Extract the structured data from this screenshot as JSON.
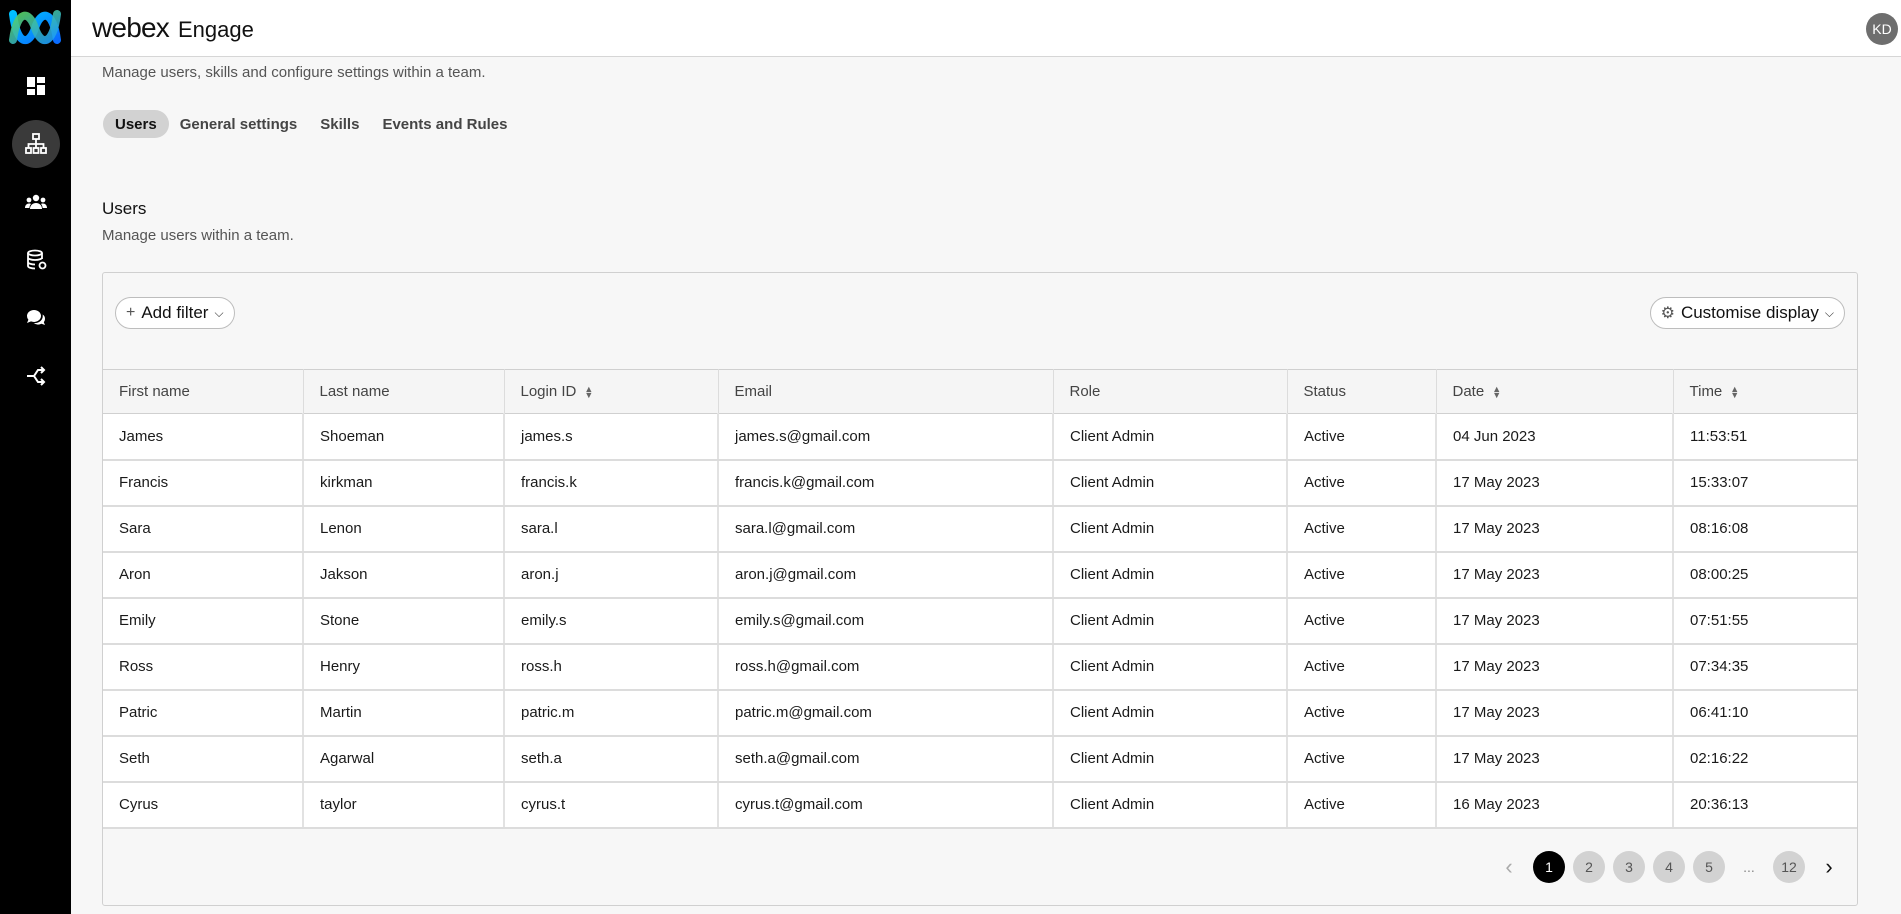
{
  "header": {
    "brand": "webex",
    "product": "Engage",
    "user_initials": "KD"
  },
  "sidebar": {
    "items": [
      {
        "icon": "dashboard-icon"
      },
      {
        "icon": "org-chart-icon",
        "active": true
      },
      {
        "icon": "team-icon"
      },
      {
        "icon": "database-icon"
      },
      {
        "icon": "chat-bubbles-icon"
      },
      {
        "icon": "routing-icon"
      }
    ]
  },
  "page": {
    "subtitle": "Manage users, skills and configure settings within a team.",
    "tabs": [
      "Users",
      "General settings",
      "Skills",
      "Events and Rules"
    ],
    "active_tab": "Users",
    "section_title": "Users",
    "section_desc": "Manage users within a team."
  },
  "toolbar": {
    "add_filter": "Add filter",
    "customise": "Customise display"
  },
  "table": {
    "columns": [
      "First name",
      "Last name",
      "Login ID",
      "Email",
      "Role",
      "Status",
      "Date",
      "Time"
    ],
    "rows": [
      [
        "James",
        "Shoeman",
        "james.s",
        "james.s@gmail.com",
        "Client Admin",
        "Active",
        "04 Jun 2023",
        "11:53:51"
      ],
      [
        "Francis",
        "kirkman",
        "francis.k",
        "francis.k@gmail.com",
        "Client Admin",
        "Active",
        "17 May 2023",
        "15:33:07"
      ],
      [
        "Sara",
        "Lenon",
        "sara.l",
        "sara.l@gmail.com",
        "Client Admin",
        "Active",
        "17 May 2023",
        "08:16:08"
      ],
      [
        "Aron",
        "Jakson",
        "aron.j",
        "aron.j@gmail.com",
        "Client Admin",
        "Active",
        "17 May 2023",
        "08:00:25"
      ],
      [
        "Emily",
        "Stone",
        "emily.s",
        "emily.s@gmail.com",
        "Client Admin",
        "Active",
        "17 May 2023",
        "07:51:55"
      ],
      [
        "Ross",
        "Henry",
        "ross.h",
        "ross.h@gmail.com",
        "Client Admin",
        "Active",
        "17 May 2023",
        "07:34:35"
      ],
      [
        "Patric",
        "Martin",
        "patric.m",
        "patric.m@gmail.com",
        "Client Admin",
        "Active",
        "17 May 2023",
        "06:41:10"
      ],
      [
        "Seth",
        "Agarwal",
        "seth.a",
        "seth.a@gmail.com",
        "Client Admin",
        "Active",
        "17 May 2023",
        "02:16:22"
      ],
      [
        "Cyrus",
        "taylor",
        "cyrus.t",
        "cyrus.t@gmail.com",
        "Client Admin",
        "Active",
        "16 May 2023",
        "20:36:13"
      ]
    ]
  },
  "pagination": {
    "pages": [
      "1",
      "2",
      "3",
      "4",
      "5"
    ],
    "ellipsis": "...",
    "last": "12",
    "current": "1"
  }
}
